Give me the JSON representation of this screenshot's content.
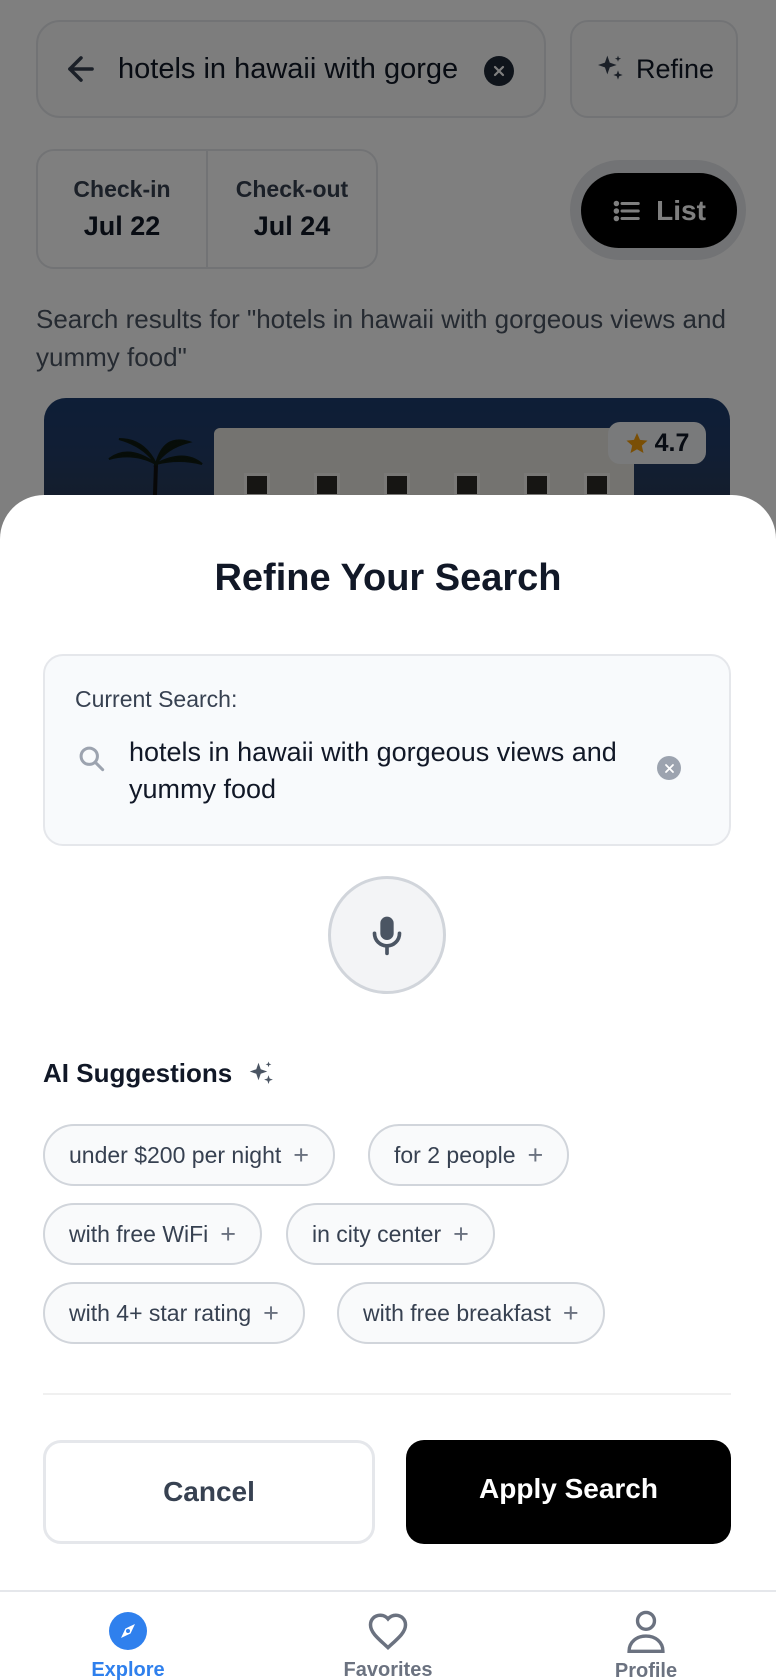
{
  "background": {
    "search_query": "hotels in hawaii with gorgeous views and yummy food",
    "refine_label": "Refine",
    "check_in_label": "Check-in",
    "check_in_value": "Jul 22",
    "check_out_label": "Check-out",
    "check_out_value": "Jul 24",
    "view_toggle_label": "List",
    "results_text": "Search results for \"hotels in hawaii with gorgeous views and yummy food\"",
    "rating": "4.7"
  },
  "sheet": {
    "title": "Refine Your Search",
    "current_label": "Current Search:",
    "current_query": "hotels in hawaii with gorgeous views and yummy food",
    "ai_heading": "AI Suggestions",
    "suggestions": [
      "under $200 per night",
      "for 2 people",
      "with free WiFi",
      "in city center",
      "with 4+ star rating",
      "with free breakfast"
    ],
    "cancel_label": "Cancel",
    "apply_label": "Apply Search"
  },
  "nav": {
    "items": [
      {
        "label": "Explore",
        "icon": "compass-icon",
        "active": true
      },
      {
        "label": "Favorites",
        "icon": "heart-icon",
        "active": false
      },
      {
        "label": "Profile",
        "icon": "user-icon",
        "active": false
      }
    ]
  },
  "colors": {
    "accent": "#2f80ed",
    "primary_button": "#000000",
    "star": "#f59e0b"
  }
}
